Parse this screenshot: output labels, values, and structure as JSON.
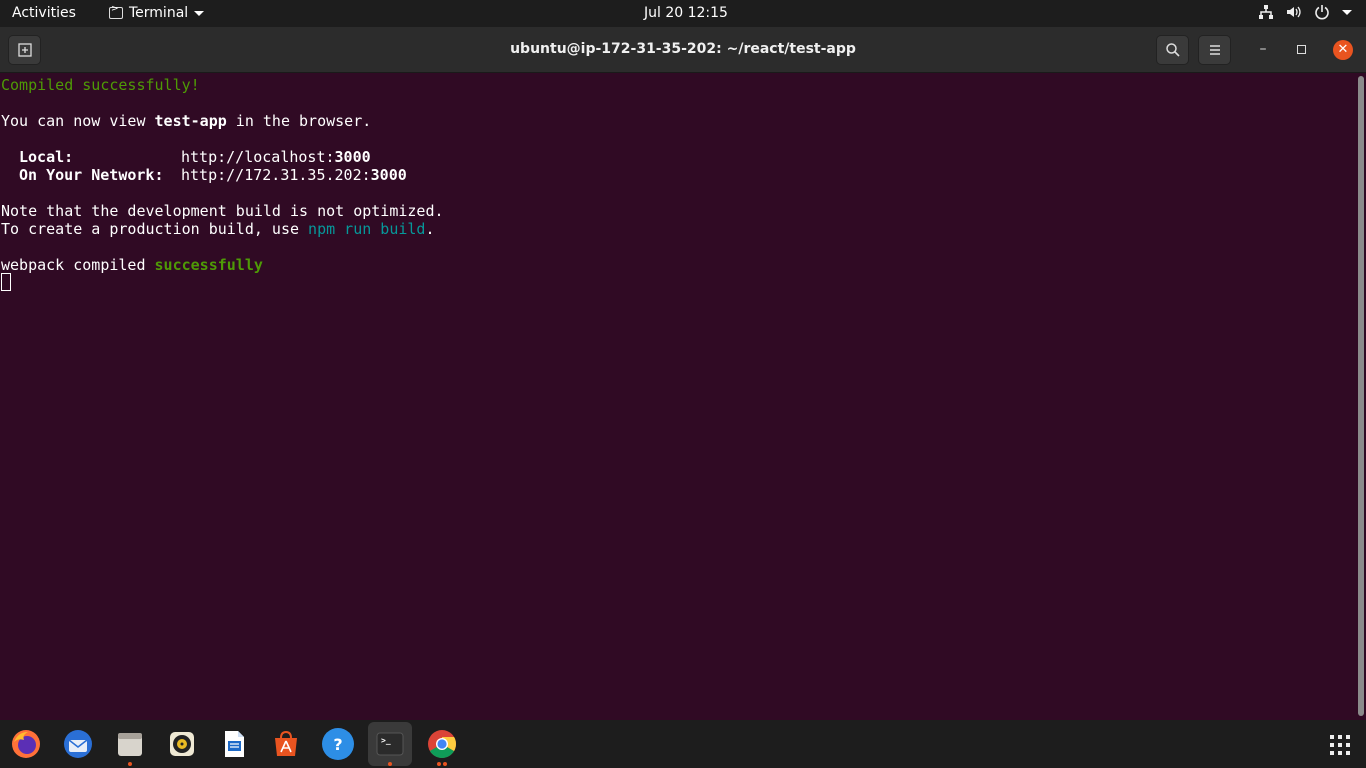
{
  "topbar": {
    "activities": "Activities",
    "app_name": "Terminal",
    "clock": "Jul 20  12:15"
  },
  "window": {
    "title": "ubuntu@ip-172-31-35-202: ~/react/test-app"
  },
  "terminal": {
    "line1": "Compiled successfully!",
    "line2_a": "You can now view ",
    "line2_b": "test-app",
    "line2_c": " in the browser.",
    "local_label": "Local:",
    "local_url_a": "http://localhost:",
    "local_url_b": "3000",
    "network_label": "On Your Network:",
    "network_url_a": "http://172.31.35.202:",
    "network_url_b": "3000",
    "note1": "Note that the development build is not optimized.",
    "note2_a": "To create a production build, use ",
    "note2_b": "npm run build",
    "note2_c": ".",
    "webpack_a": "webpack compiled ",
    "webpack_b": "successfully"
  },
  "colors": {
    "terminal_bg": "#300a24",
    "green": "#4e9a06",
    "cyan": "#06989a",
    "accent": "#e95420"
  },
  "dock": {
    "items": [
      "firefox-icon",
      "thunderbird-icon",
      "files-icon",
      "rhythmbox-icon",
      "libreoffice-writer-icon",
      "ubuntu-software-icon",
      "help-icon",
      "terminal-icon",
      "chrome-icon"
    ]
  }
}
